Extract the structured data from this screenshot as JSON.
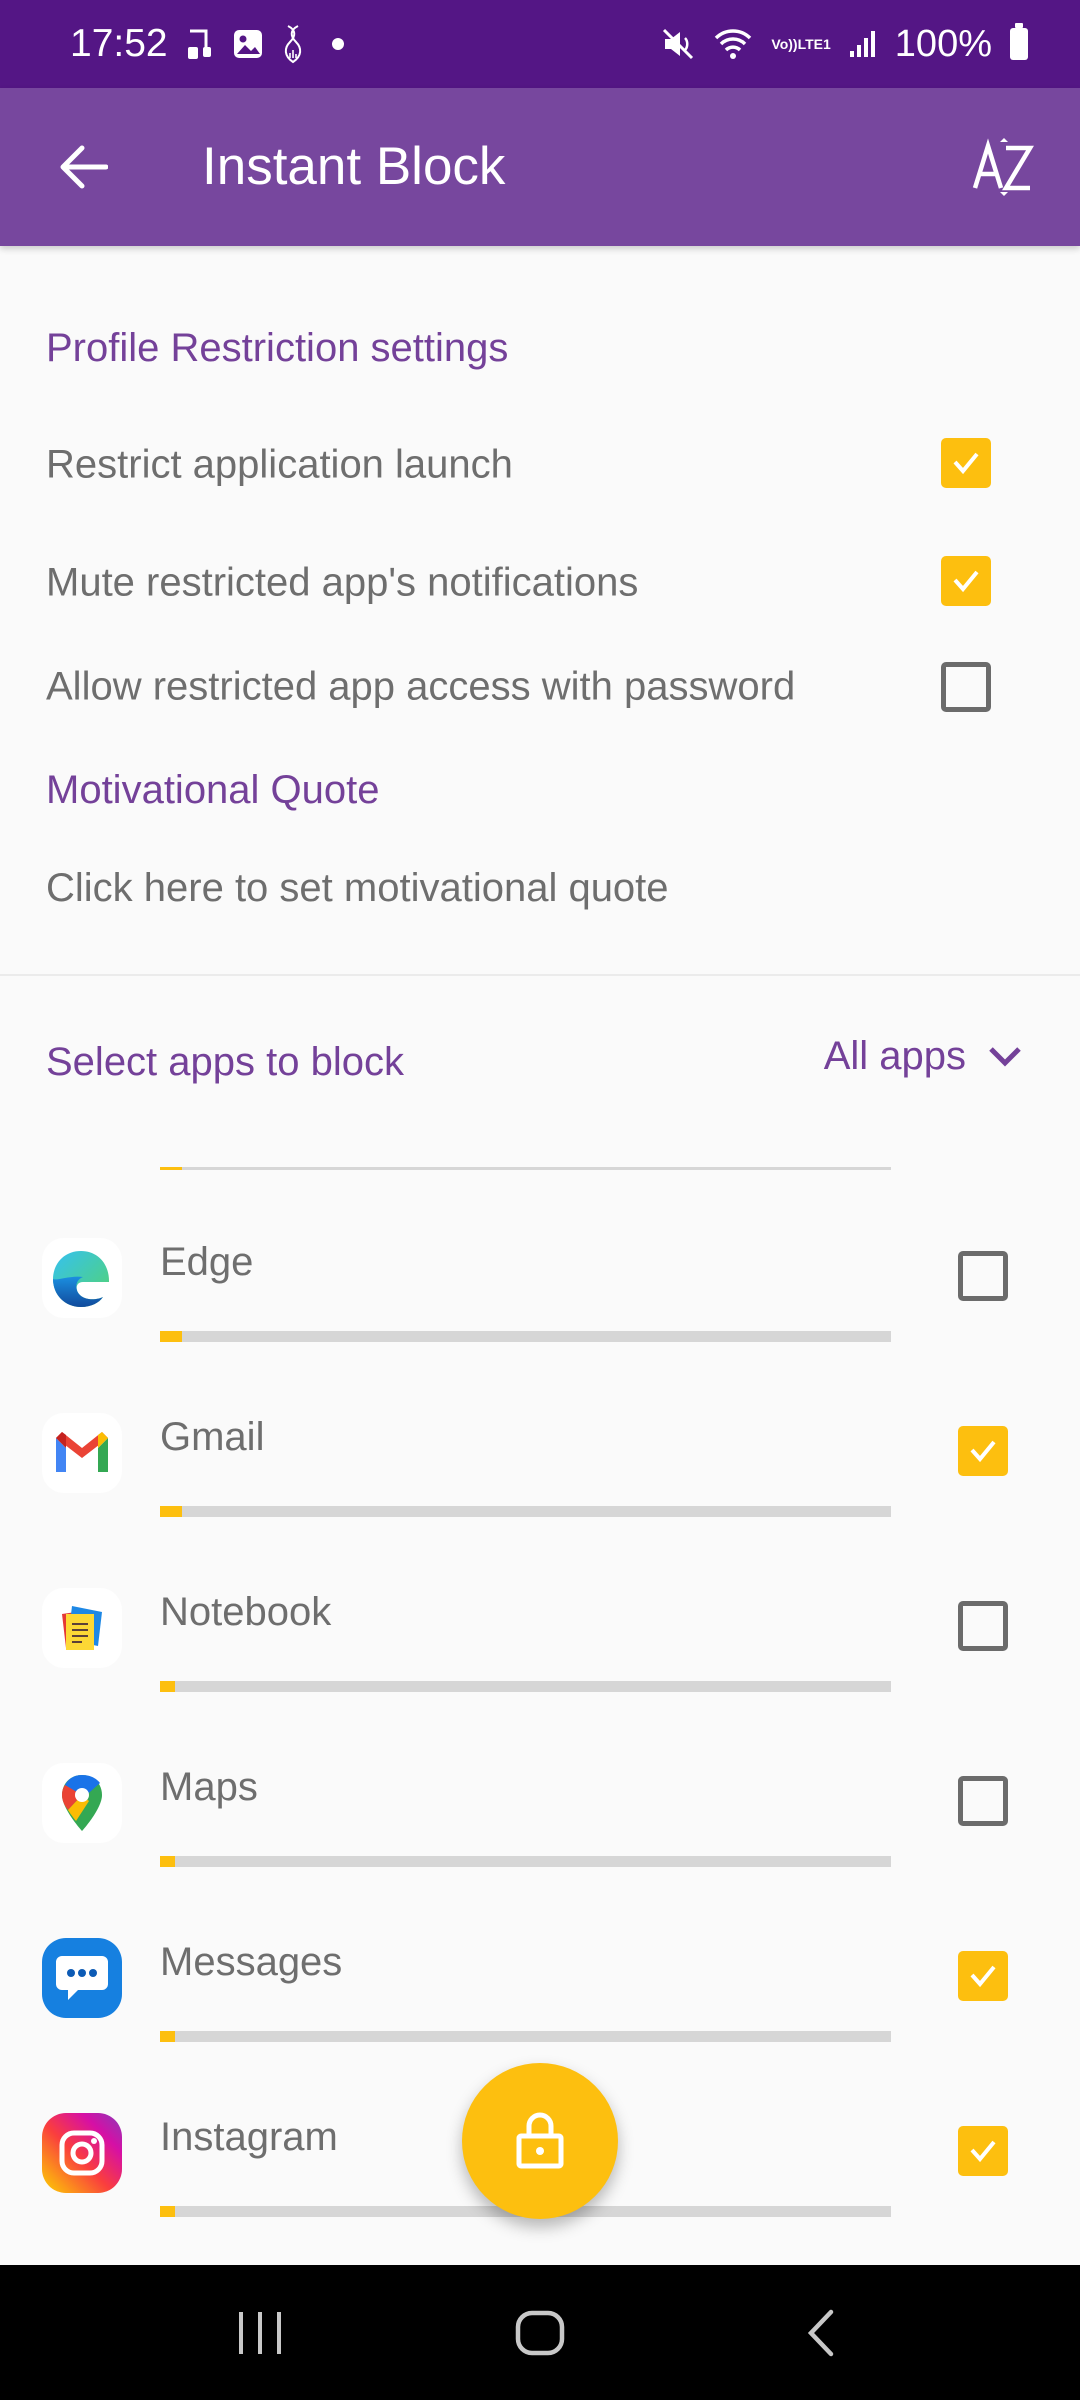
{
  "status_bar": {
    "time": "17:52",
    "left_icons": [
      "ringtone-lock-icon",
      "gallery-icon",
      "health-icon",
      "notification-dot"
    ],
    "right_icons": [
      "mute-icon",
      "wifi-icon",
      "volte-lte-icon",
      "signal-icon"
    ],
    "volte_label": "Vo))",
    "lte_label": "LTE1",
    "battery": "100%"
  },
  "app_bar": {
    "title": "Instant Block",
    "back_icon": "arrow-left-icon",
    "sort_icon": "sort-az-icon",
    "sort_label_a": "A",
    "sort_label_z": "Z"
  },
  "profile_settings": {
    "title": "Profile Restriction settings",
    "items": [
      {
        "label": "Restrict application launch",
        "checked": true
      },
      {
        "label": "Mute restricted app's notifications",
        "checked": true
      },
      {
        "label": "Allow restricted app access with password",
        "checked": false
      }
    ]
  },
  "motivational_quote": {
    "title": "Motivational Quote",
    "placeholder": "Click here to set motivational quote"
  },
  "apps_section": {
    "title": "Select apps to block",
    "filter": {
      "selected": "All apps",
      "icon": "chevron-down-icon"
    },
    "partial_row_progress": 0.03,
    "apps": [
      {
        "name": "Edge",
        "icon": "edge-icon",
        "checked": false,
        "usage_fraction": 0.03
      },
      {
        "name": "Gmail",
        "icon": "gmail-icon",
        "checked": true,
        "usage_fraction": 0.03
      },
      {
        "name": "Notebook",
        "icon": "notebook-icon",
        "checked": false,
        "usage_fraction": 0.02
      },
      {
        "name": "Maps",
        "icon": "maps-icon",
        "checked": false,
        "usage_fraction": 0.02
      },
      {
        "name": "Messages",
        "icon": "messages-icon",
        "checked": true,
        "usage_fraction": 0.02
      },
      {
        "name": "Instagram",
        "icon": "instagram-icon",
        "checked": true,
        "usage_fraction": 0.02
      }
    ]
  },
  "fab": {
    "icon": "lock-icon"
  },
  "nav_bar": {
    "buttons": [
      "recents-icon",
      "home-icon",
      "back-icon"
    ]
  },
  "colors": {
    "status_bar": "#541685",
    "app_bar": "#77479e",
    "accent_text": "#744199",
    "checkbox_checked": "#fdbf0f",
    "progress_track": "#d6d6d6",
    "progress_fill": "#fdbf0f",
    "background": "#fafafa"
  }
}
